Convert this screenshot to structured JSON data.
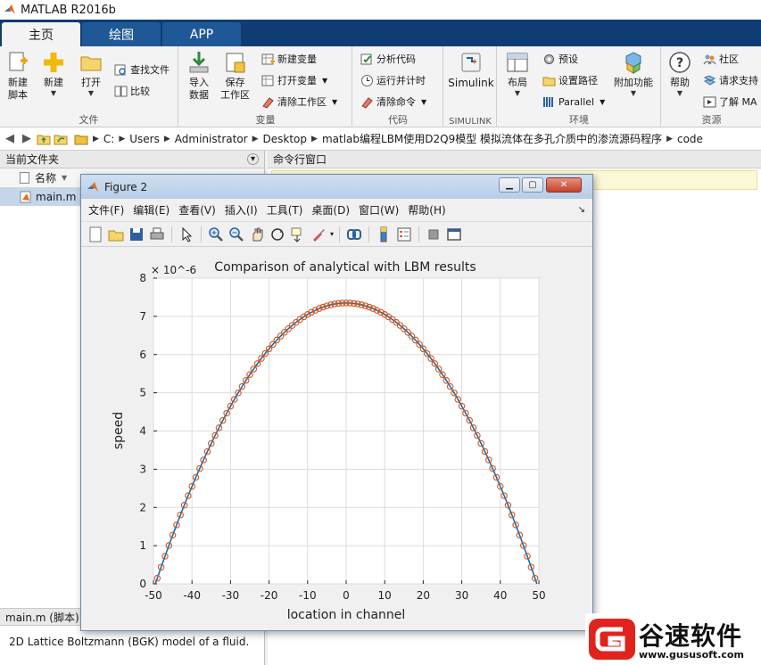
{
  "app": {
    "title": "MATLAB R2016b"
  },
  "tabs": [
    {
      "label": "主页",
      "active": true
    },
    {
      "label": "绘图",
      "active": false
    },
    {
      "label": "APP",
      "active": false
    }
  ],
  "ribbon": {
    "file": {
      "label": "文件",
      "new_script": "新建\n脚本",
      "new": "新建",
      "open": "打开",
      "find_files": "查找文件",
      "compare": "比较"
    },
    "variable": {
      "label": "变量",
      "import": "导入\n数据",
      "save_ws": "保存\n工作区",
      "new_var": "新建变量",
      "open_var": "打开变量",
      "clear_ws": "清除工作区"
    },
    "code": {
      "label": "代码",
      "analyze": "分析代码",
      "run_time": "运行并计时",
      "clear_cmd": "清除命令"
    },
    "simulink": {
      "label": "SIMULINK",
      "button": "Simulink"
    },
    "environment": {
      "label": "环境",
      "layout": "布局",
      "preferences": "预设",
      "set_path": "设置路径",
      "parallel": "Parallel",
      "addons": "附加功能"
    },
    "resources": {
      "label": "资源",
      "help": "帮助",
      "community": "社区",
      "request_support": "请求支持",
      "learn": "了解 MA"
    }
  },
  "address": {
    "crumbs": [
      "C:",
      "Users",
      "Administrator",
      "Desktop",
      "matlab编程LBM使用D2Q9模型 模拟流体在多孔介质中的渗流源码程序",
      "code"
    ]
  },
  "current_folder": {
    "title": "当前文件夹",
    "col_name": "名称",
    "files": [
      {
        "name": "main.m"
      }
    ],
    "details_title": "main.m  (脚本)",
    "details_text": "2D Lattice Boltzmann (BGK) model of a fluid."
  },
  "command_window": {
    "title": "命令行窗口"
  },
  "figure": {
    "title": "Figure 2",
    "menu": [
      "文件(F)",
      "编辑(E)",
      "查看(V)",
      "插入(I)",
      "工具(T)",
      "桌面(D)",
      "窗口(W)",
      "帮助(H)"
    ],
    "tools": [
      "new-icon",
      "open-icon",
      "save-icon",
      "print-icon",
      "pointer-icon",
      "zoom-in-icon",
      "zoom-out-icon",
      "pan-icon",
      "rotate-icon",
      "data-cursor-icon",
      "brush-icon",
      "link-icon",
      "colorbar-icon",
      "legend-icon",
      "hide-tools-icon",
      "dock-icon"
    ]
  },
  "chart_data": {
    "type": "line",
    "title": "Comparison of analytical with LBM results",
    "xlabel": "location in channel",
    "ylabel": "speed",
    "y_exponent": "× 10^-6",
    "xlim": [
      -50,
      50
    ],
    "ylim": [
      0,
      8
    ],
    "xticks": [
      -50,
      -40,
      -30,
      -20,
      -10,
      0,
      10,
      20,
      30,
      40,
      50
    ],
    "yticks": [
      0,
      1,
      2,
      3,
      4,
      5,
      6,
      7,
      8
    ],
    "grid": true,
    "series": [
      {
        "style": "line",
        "color": "#0072bd",
        "peak": 7.35,
        "half_width": 49.5
      },
      {
        "style": "circle-markers",
        "color": "#d95319",
        "x_start": -49,
        "x_end": 49,
        "step": 1,
        "peak": 7.35,
        "half_width": 49.5
      }
    ]
  },
  "watermark": {
    "text": "谷速软件",
    "url": "www.gususoft.com"
  }
}
